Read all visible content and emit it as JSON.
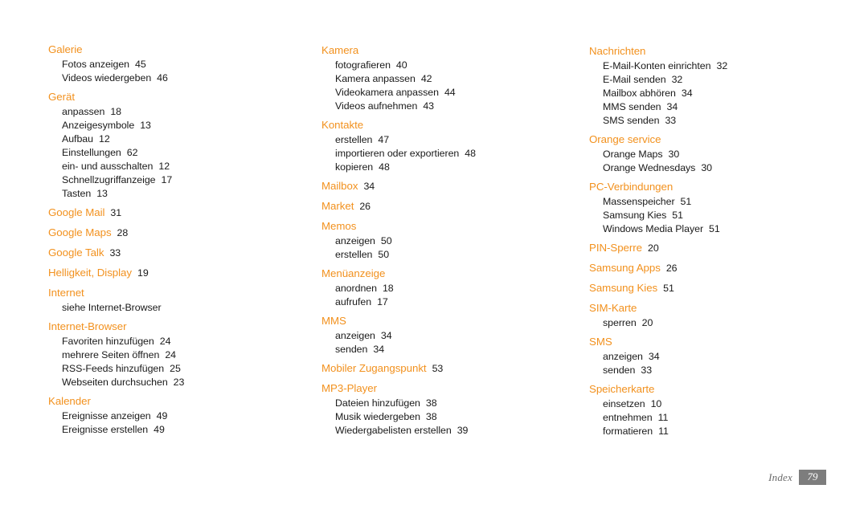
{
  "document": {
    "type": "index",
    "accent_color": "#f2911e",
    "text_color": "#1a1a1a",
    "background_color": "#ffffff"
  },
  "footer": {
    "label": "Index",
    "page_number": "79",
    "box_color": "#7d7d7d"
  },
  "columns": [
    {
      "groups": [
        {
          "heading": "Galerie",
          "heading_page": "",
          "entries": [
            {
              "text": "Fotos anzeigen",
              "page": "45"
            },
            {
              "text": "Videos wiedergeben",
              "page": "46"
            }
          ]
        },
        {
          "heading": "Gerät",
          "heading_page": "",
          "entries": [
            {
              "text": "anpassen",
              "page": "18"
            },
            {
              "text": "Anzeigesymbole",
              "page": "13"
            },
            {
              "text": "Aufbau",
              "page": "12"
            },
            {
              "text": "Einstellungen",
              "page": "62"
            },
            {
              "text": "ein- und ausschalten",
              "page": "12"
            },
            {
              "text": "Schnellzugriffanzeige",
              "page": "17"
            },
            {
              "text": "Tasten",
              "page": "13"
            }
          ]
        },
        {
          "heading": "Google Mail",
          "heading_page": "31",
          "entries": []
        },
        {
          "heading": "Google Maps",
          "heading_page": "28",
          "entries": []
        },
        {
          "heading": "Google Talk",
          "heading_page": "33",
          "entries": []
        },
        {
          "heading": "Helligkeit, Display",
          "heading_page": "19",
          "entries": []
        },
        {
          "heading": "Internet",
          "heading_page": "",
          "entries": [
            {
              "text": "siehe Internet-Browser",
              "page": ""
            }
          ]
        },
        {
          "heading": "Internet-Browser",
          "heading_page": "",
          "entries": [
            {
              "text": "Favoriten hinzufügen",
              "page": "24"
            },
            {
              "text": "mehrere Seiten öffnen",
              "page": "24"
            },
            {
              "text": "RSS-Feeds hinzufügen",
              "page": "25"
            },
            {
              "text": "Webseiten durchsuchen",
              "page": "23"
            }
          ]
        },
        {
          "heading": "Kalender",
          "heading_page": "",
          "entries": [
            {
              "text": "Ereignisse anzeigen",
              "page": "49"
            },
            {
              "text": "Ereignisse erstellen",
              "page": "49"
            }
          ]
        }
      ]
    },
    {
      "groups": [
        {
          "heading": "Kamera",
          "heading_page": "",
          "entries": [
            {
              "text": "fotografieren",
              "page": "40"
            },
            {
              "text": "Kamera anpassen",
              "page": "42"
            },
            {
              "text": "Videokamera anpassen",
              "page": "44"
            },
            {
              "text": "Videos aufnehmen",
              "page": "43"
            }
          ]
        },
        {
          "heading": "Kontakte",
          "heading_page": "",
          "entries": [
            {
              "text": "erstellen",
              "page": "47"
            },
            {
              "text": "importieren oder exportieren",
              "page": "48"
            },
            {
              "text": "kopieren",
              "page": "48"
            }
          ]
        },
        {
          "heading": "Mailbox",
          "heading_page": "34",
          "entries": []
        },
        {
          "heading": "Market",
          "heading_page": "26",
          "entries": []
        },
        {
          "heading": "Memos",
          "heading_page": "",
          "entries": [
            {
              "text": "anzeigen",
              "page": "50"
            },
            {
              "text": "erstellen",
              "page": "50"
            }
          ]
        },
        {
          "heading": "Menüanzeige",
          "heading_page": "",
          "entries": [
            {
              "text": "anordnen",
              "page": "18"
            },
            {
              "text": "aufrufen",
              "page": "17"
            }
          ]
        },
        {
          "heading": "MMS",
          "heading_page": "",
          "entries": [
            {
              "text": "anzeigen",
              "page": "34"
            },
            {
              "text": "senden",
              "page": "34"
            }
          ]
        },
        {
          "heading": "Mobiler Zugangspunkt",
          "heading_page": "53",
          "entries": []
        },
        {
          "heading": "MP3-Player",
          "heading_page": "",
          "entries": [
            {
              "text": "Dateien hinzufügen",
              "page": "38"
            },
            {
              "text": "Musik wiedergeben",
              "page": "38"
            },
            {
              "text": "Wiedergabelisten erstellen",
              "page": "39"
            }
          ]
        }
      ]
    },
    {
      "groups": [
        {
          "heading": "Nachrichten",
          "heading_page": "",
          "entries": [
            {
              "text": "E-Mail-Konten einrichten",
              "page": "32"
            },
            {
              "text": "E-Mail senden",
              "page": "32"
            },
            {
              "text": "Mailbox abhören",
              "page": "34"
            },
            {
              "text": "MMS senden",
              "page": "34"
            },
            {
              "text": "SMS senden",
              "page": "33"
            }
          ]
        },
        {
          "heading": "Orange service",
          "heading_page": "",
          "entries": [
            {
              "text": "Orange Maps",
              "page": "30"
            },
            {
              "text": "Orange Wednesdays",
              "page": "30"
            }
          ]
        },
        {
          "heading": "PC-Verbindungen",
          "heading_page": "",
          "entries": [
            {
              "text": "Massenspeicher",
              "page": "51"
            },
            {
              "text": "Samsung Kies",
              "page": "51"
            },
            {
              "text": "Windows Media Player",
              "page": "51"
            }
          ]
        },
        {
          "heading": "PIN-Sperre",
          "heading_page": "20",
          "entries": []
        },
        {
          "heading": "Samsung Apps",
          "heading_page": "26",
          "entries": []
        },
        {
          "heading": "Samsung Kies",
          "heading_page": "51",
          "entries": []
        },
        {
          "heading": "SIM-Karte",
          "heading_page": "",
          "entries": [
            {
              "text": "sperren",
              "page": "20"
            }
          ]
        },
        {
          "heading": "SMS",
          "heading_page": "",
          "entries": [
            {
              "text": "anzeigen",
              "page": "34"
            },
            {
              "text": "senden",
              "page": "33"
            }
          ]
        },
        {
          "heading": "Speicherkarte",
          "heading_page": "",
          "entries": [
            {
              "text": "einsetzen",
              "page": "10"
            },
            {
              "text": "entnehmen",
              "page": "11"
            },
            {
              "text": "formatieren",
              "page": "11"
            }
          ]
        }
      ]
    }
  ]
}
